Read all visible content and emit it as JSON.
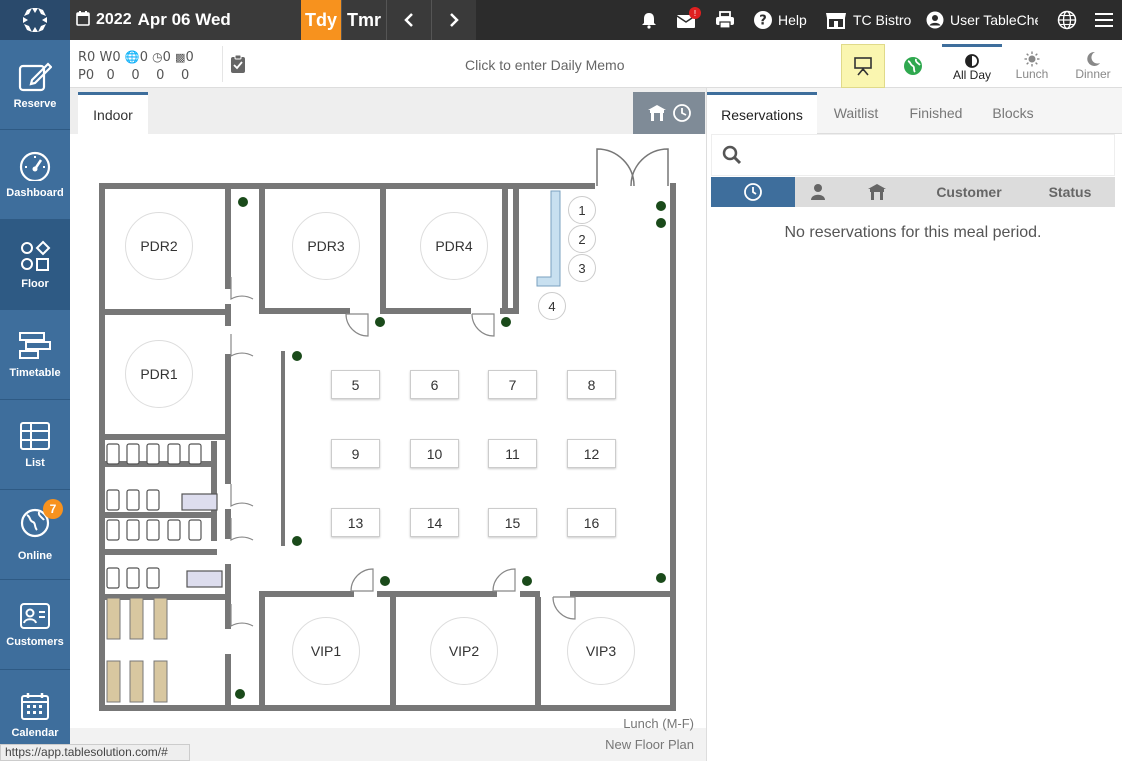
{
  "topbar": {
    "year": "2022",
    "date": "Apr 06 Wed",
    "today_label": "Tdy",
    "tomorrow_label": "Tmr",
    "help_label": "Help",
    "restaurant_name": "TC Bistro",
    "user_name": "User TableChec",
    "notification_badge": "!",
    "brand_color": "#f7921e"
  },
  "sidebar": {
    "items": [
      {
        "label": "Reserve",
        "icon": "edit-icon"
      },
      {
        "label": "Dashboard",
        "icon": "gauge-icon"
      },
      {
        "label": "Floor",
        "icon": "shapes-icon"
      },
      {
        "label": "Timetable",
        "icon": "timetable-icon"
      },
      {
        "label": "List",
        "icon": "table-icon"
      },
      {
        "label": "Online",
        "icon": "globe-icon",
        "badge": "7"
      },
      {
        "label": "Customers",
        "icon": "id-card-icon"
      },
      {
        "label": "Calendar",
        "icon": "calendar-icon"
      }
    ],
    "active": "Floor"
  },
  "counts": {
    "r_label": "R",
    "r_value": "0",
    "w_label": "W",
    "w_value": "0",
    "online_value": "0",
    "time_value": "0",
    "seat_value": "0",
    "p_label": "P",
    "p_values": [
      "0",
      "0",
      "0",
      "0",
      "0"
    ]
  },
  "memo": {
    "placeholder": "Click to enter Daily Memo"
  },
  "meals": [
    {
      "label": "All Day",
      "active": true
    },
    {
      "label": "Lunch",
      "active": false
    },
    {
      "label": "Dinner",
      "active": false
    }
  ],
  "floor": {
    "tab": "Indoor",
    "rooms": [
      "PDR2",
      "PDR3",
      "PDR4",
      "PDR1",
      "VIP1",
      "VIP2",
      "VIP3"
    ],
    "counter_seats": [
      "1",
      "2",
      "3",
      "4"
    ],
    "tables": [
      "5",
      "6",
      "7",
      "8",
      "9",
      "10",
      "11",
      "12",
      "13",
      "14",
      "15",
      "16"
    ],
    "meal_period": "Lunch (M-F)",
    "floor_plan_name": "New Floor Plan"
  },
  "right_panel": {
    "tabs": [
      "Reservations",
      "Waitlist",
      "Finished",
      "Blocks"
    ],
    "columns": {
      "customer": "Customer",
      "status": "Status"
    },
    "empty_message": "No reservations for this meal period."
  },
  "status_url": "https://app.tablesolution.com/#"
}
